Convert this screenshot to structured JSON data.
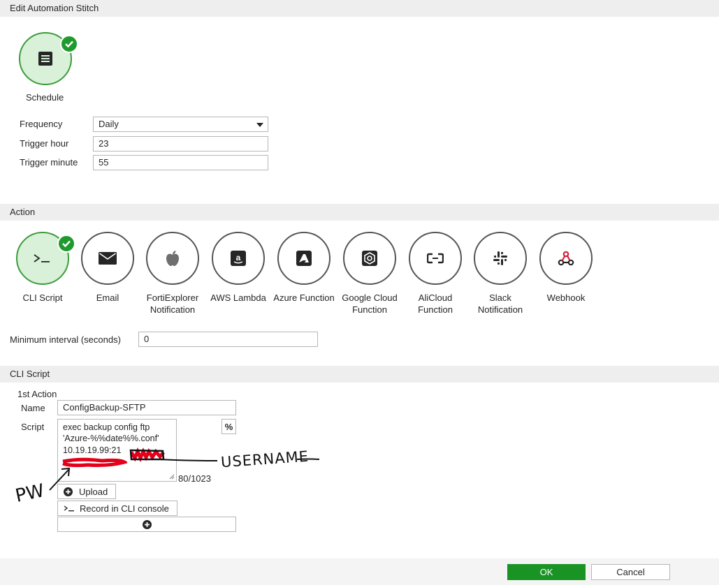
{
  "window": {
    "title": "Edit Automation Stitch"
  },
  "trigger": {
    "name": "Schedule",
    "fields": {
      "frequency": {
        "label": "Frequency",
        "value": "Daily"
      },
      "trigger_hour": {
        "label": "Trigger hour",
        "value": "23"
      },
      "trigger_minute": {
        "label": "Trigger minute",
        "value": "55"
      }
    }
  },
  "action_section": {
    "title": "Action",
    "actions": [
      {
        "label": "CLI Script",
        "selected": true
      },
      {
        "label": "Email"
      },
      {
        "label": "FortiExplorer Notification"
      },
      {
        "label": "AWS Lambda"
      },
      {
        "label": "Azure Function"
      },
      {
        "label": "Google Cloud Function"
      },
      {
        "label": "AliCloud Function"
      },
      {
        "label": "Slack Notification"
      },
      {
        "label": "Webhook"
      }
    ],
    "min_interval": {
      "label": "Minimum interval (seconds)",
      "value": "0"
    }
  },
  "cli_section": {
    "title": "CLI Script",
    "action_title": "1st Action",
    "name_label": "Name",
    "name_value": "ConfigBackup-SFTP",
    "script_label": "Script",
    "script_lines": [
      "exec backup config ftp",
      "'Azure-%%date%%.conf'",
      "10.19.19.99:21"
    ],
    "percent_button": "%",
    "char_count": "80/1023",
    "upload_label": "Upload",
    "record_label": "Record in CLI console"
  },
  "annotations": {
    "username": "USERNAME",
    "pw": "PW"
  },
  "footer": {
    "ok": "OK",
    "cancel": "Cancel"
  },
  "colors": {
    "accent_green": "#199324",
    "selected_circle_fill": "#d8f1d8",
    "redaction_red": "#e3001b"
  }
}
